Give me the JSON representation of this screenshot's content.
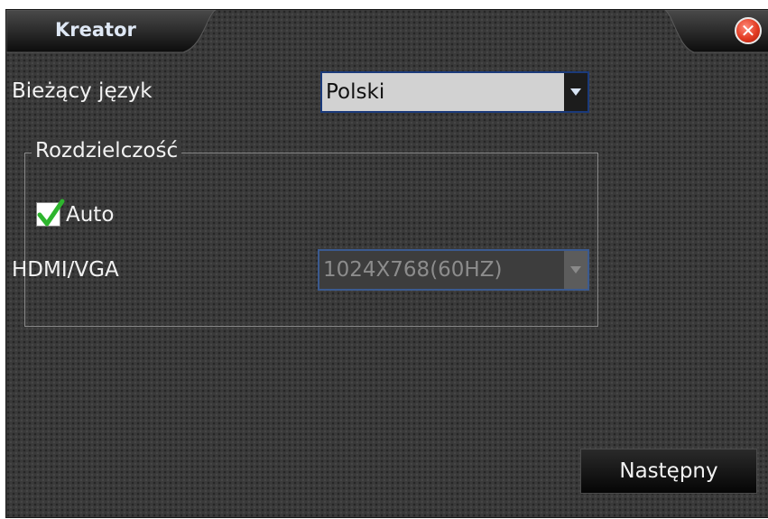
{
  "window": {
    "title": "Kreator"
  },
  "language": {
    "label": "Bieżący język",
    "selected": "Polski"
  },
  "resolution": {
    "group_title": "Rozdzielczość",
    "auto_label": "Auto",
    "auto_checked": true,
    "output_label": "HDMI/VGA",
    "selected": "1024X768(60HZ)",
    "disabled": true
  },
  "buttons": {
    "next_label": "Następny"
  },
  "icons": {
    "close": "close-icon",
    "dropdown": "chevron-down-icon",
    "check": "checkmark-icon"
  },
  "colors": {
    "background": "#3a3a3a",
    "title_text": "#dfe8f5",
    "close_button": "#e23b22",
    "check": "#2db52d",
    "dropdown_border": "#1b3a7a"
  }
}
